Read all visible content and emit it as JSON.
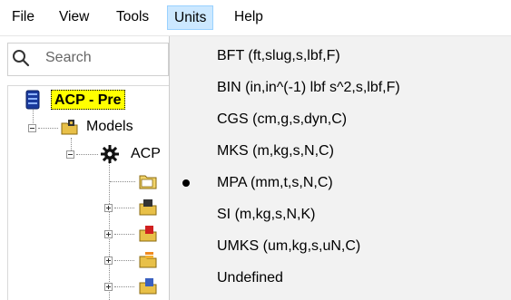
{
  "menubar": {
    "items": [
      {
        "label": "File"
      },
      {
        "label": "View"
      },
      {
        "label": "Tools"
      },
      {
        "label": "Units"
      },
      {
        "label": "Help"
      }
    ],
    "active": "Units"
  },
  "search": {
    "placeholder": "Search"
  },
  "tree": {
    "root_label": "ACP - Pre",
    "models_label": "Models",
    "acp_label": "ACP"
  },
  "units_menu": {
    "items": [
      {
        "label": "BFT (ft,slug,s,lbf,F)",
        "checked": false
      },
      {
        "label": "BIN (in,in^(-1) lbf s^2,s,lbf,F)",
        "checked": false
      },
      {
        "label": "CGS (cm,g,s,dyn,C)",
        "checked": false
      },
      {
        "label": "MKS (m,kg,s,N,C)",
        "checked": false
      },
      {
        "label": "MPA (mm,t,s,N,C)",
        "checked": true
      },
      {
        "label": "SI (m,kg,s,N,K)",
        "checked": false
      },
      {
        "label": "UMKS (um,kg,s,uN,C)",
        "checked": false
      },
      {
        "label": "Undefined",
        "checked": false
      }
    ]
  },
  "colors": {
    "active_menu_bg": "#cce8ff",
    "active_menu_border": "#99d1ff",
    "dropdown_bg": "#f2f2f2",
    "root_highlight": "#ffff00"
  }
}
